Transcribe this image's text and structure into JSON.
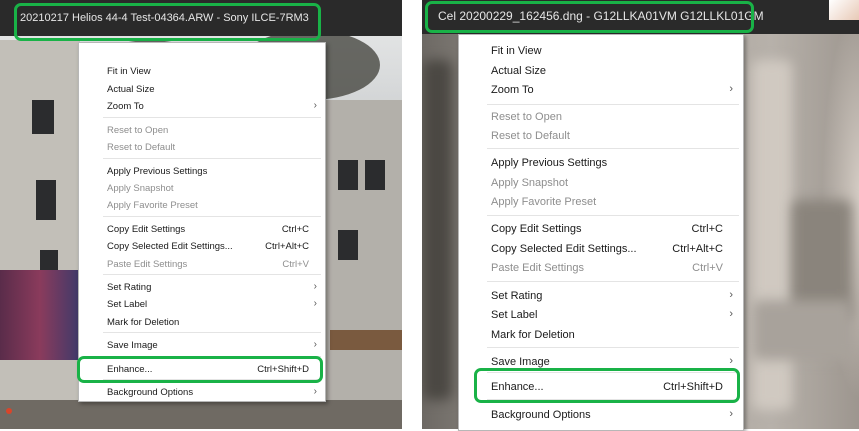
{
  "left": {
    "title": "20210217 Helios 44-4 Test-04364.ARW  -  Sony ILCE-7RM3",
    "menu": [
      {
        "label": "Fit in View"
      },
      {
        "label": "Actual Size"
      },
      {
        "label": "Zoom To",
        "arrow": "›"
      },
      {
        "label": "Reset to Open",
        "disabled": true
      },
      {
        "label": "Reset to Default",
        "disabled": true
      },
      {
        "label": "Apply Previous Settings"
      },
      {
        "label": "Apply Snapshot",
        "disabled": true
      },
      {
        "label": "Apply Favorite Preset",
        "disabled": true
      },
      {
        "label": "Copy Edit Settings",
        "shortcut": "Ctrl+C"
      },
      {
        "label": "Copy Selected Edit Settings...",
        "shortcut": "Ctrl+Alt+C"
      },
      {
        "label": "Paste Edit Settings",
        "shortcut": "Ctrl+V",
        "disabled": true
      },
      {
        "label": "Set Rating",
        "arrow": "›"
      },
      {
        "label": "Set Label",
        "arrow": "›"
      },
      {
        "label": "Mark for Deletion"
      },
      {
        "label": "Save Image",
        "arrow": "›"
      },
      {
        "label": "Enhance...",
        "shortcut": "Ctrl+Shift+D"
      },
      {
        "label": "Background Options",
        "arrow": "›"
      }
    ]
  },
  "right": {
    "title": "Cel 20200229_162456.dng  -  G12LLKA01VM G12LLKL01GM",
    "menu": [
      {
        "label": "Fit in View"
      },
      {
        "label": "Actual Size"
      },
      {
        "label": "Zoom To",
        "arrow": "›"
      },
      {
        "label": "Reset to Open",
        "disabled": true
      },
      {
        "label": "Reset to Default",
        "disabled": true
      },
      {
        "label": "Apply Previous Settings"
      },
      {
        "label": "Apply Snapshot",
        "disabled": true
      },
      {
        "label": "Apply Favorite Preset",
        "disabled": true
      },
      {
        "label": "Copy Edit Settings",
        "shortcut": "Ctrl+C"
      },
      {
        "label": "Copy Selected Edit Settings...",
        "shortcut": "Ctrl+Alt+C"
      },
      {
        "label": "Paste Edit Settings",
        "shortcut": "Ctrl+V",
        "disabled": true
      },
      {
        "label": "Set Rating",
        "arrow": "›"
      },
      {
        "label": "Set Label",
        "arrow": "›"
      },
      {
        "label": "Mark for Deletion"
      },
      {
        "label": "Save Image",
        "arrow": "›"
      },
      {
        "label": "Enhance...",
        "shortcut": "Ctrl+Shift+D"
      },
      {
        "label": "Background Options",
        "arrow": "›"
      }
    ]
  },
  "colors": {
    "highlight": "#19b247",
    "titlebar": "#2a2a2a",
    "menu_bg": "#ffffff",
    "disabled_text": "#8e8e8e"
  }
}
